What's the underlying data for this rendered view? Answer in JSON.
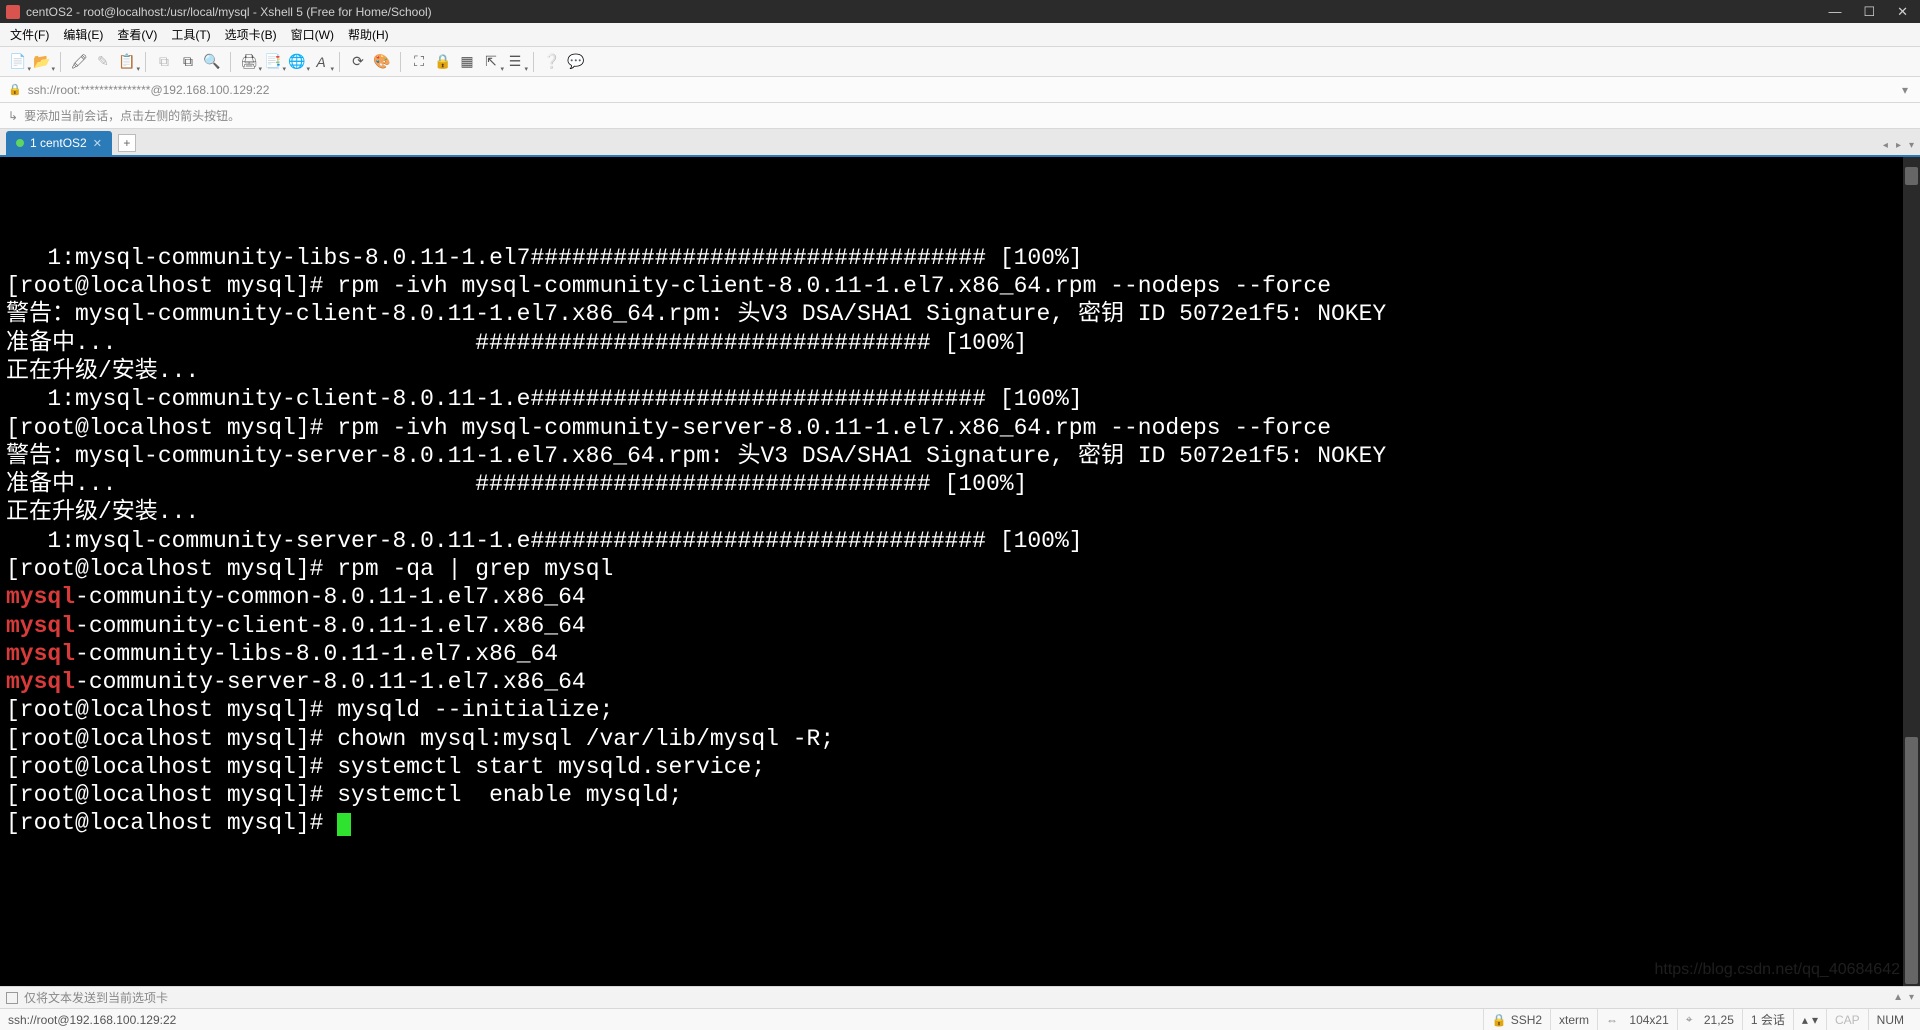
{
  "window": {
    "title": "centOS2 - root@localhost:/usr/local/mysql - Xshell 5 (Free for Home/School)"
  },
  "menu": {
    "items": [
      "文件(F)",
      "编辑(E)",
      "查看(V)",
      "工具(T)",
      "选项卡(B)",
      "窗口(W)",
      "帮助(H)"
    ]
  },
  "address": {
    "url": "ssh://root:***************@192.168.100.129:22"
  },
  "hint": {
    "text": "要添加当前会话，点击左侧的箭头按钮。"
  },
  "tabs": {
    "items": [
      {
        "label": "1 centOS2",
        "active": true
      }
    ],
    "add_label": "+"
  },
  "terminal": {
    "lines": [
      {
        "t": "   1:mysql-community-libs-8.0.11-1.el7################################# [100%]"
      },
      {
        "t": "[root@localhost mysql]# rpm -ivh mysql-community-client-8.0.11-1.el7.x86_64.rpm --nodeps --force"
      },
      {
        "t": "警告：mysql-community-client-8.0.11-1.el7.x86_64.rpm: 头V3 DSA/SHA1 Signature, 密钥 ID 5072e1f5: NOKEY"
      },
      {
        "t": "准备中...                          ################################# [100%]"
      },
      {
        "t": "正在升级/安装..."
      },
      {
        "t": "   1:mysql-community-client-8.0.11-1.e################################# [100%]"
      },
      {
        "t": "[root@localhost mysql]# rpm -ivh mysql-community-server-8.0.11-1.el7.x86_64.rpm --nodeps --force"
      },
      {
        "t": "警告：mysql-community-server-8.0.11-1.el7.x86_64.rpm: 头V3 DSA/SHA1 Signature, 密钥 ID 5072e1f5: NOKEY"
      },
      {
        "t": "准备中...                          ################################# [100%]"
      },
      {
        "t": "正在升级/安装..."
      },
      {
        "t": "   1:mysql-community-server-8.0.11-1.e################################# [100%]"
      },
      {
        "t": "[root@localhost mysql]# rpm -qa | grep mysql"
      },
      {
        "hl": "mysql",
        "t": "-community-common-8.0.11-1.el7.x86_64"
      },
      {
        "hl": "mysql",
        "t": "-community-client-8.0.11-1.el7.x86_64"
      },
      {
        "hl": "mysql",
        "t": "-community-libs-8.0.11-1.el7.x86_64"
      },
      {
        "hl": "mysql",
        "t": "-community-server-8.0.11-1.el7.x86_64"
      },
      {
        "t": "[root@localhost mysql]# mysqld --initialize;"
      },
      {
        "t": "[root@localhost mysql]# chown mysql:mysql /var/lib/mysql -R;"
      },
      {
        "t": "[root@localhost mysql]# systemctl start mysqld.service;"
      },
      {
        "t": "[root@localhost mysql]# systemctl  enable mysqld;"
      },
      {
        "t": "[root@localhost mysql]# ",
        "cursor": true
      }
    ]
  },
  "sendbar": {
    "text": "仅将文本发送到当前选项卡"
  },
  "status": {
    "conn": "ssh://root@192.168.100.129:22",
    "ssh": "SSH2",
    "term": "xterm",
    "size": "104x21",
    "pos": "21,25",
    "session_label": "1 会话",
    "cap": "CAP",
    "num": "NUM"
  },
  "icons": {
    "lock": "🔒",
    "hint_arrow": "↳"
  }
}
